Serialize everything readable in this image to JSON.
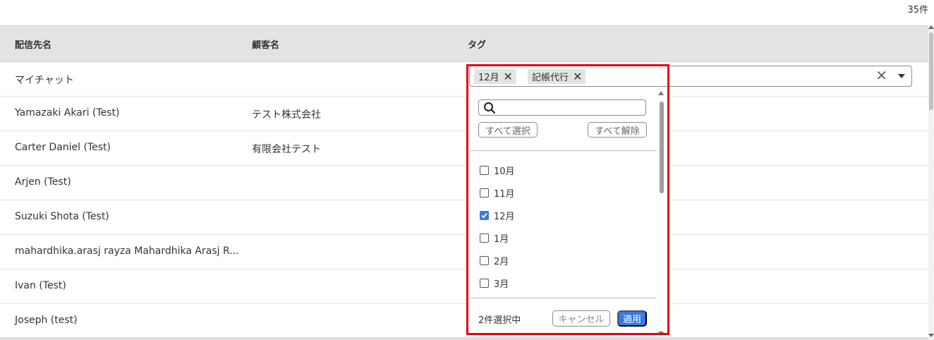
{
  "result_count": "35件",
  "table": {
    "headers": {
      "destination": "配信先名",
      "customer": "顧客名",
      "tag": "タグ"
    },
    "rows": [
      {
        "destination": "マイチャット",
        "customer": ""
      },
      {
        "destination": "Yamazaki Akari (Test)",
        "customer": "テスト株式会社"
      },
      {
        "destination": "Carter Daniel (Test)",
        "customer": "有限会社テスト"
      },
      {
        "destination": "Arjen (Test)",
        "customer": ""
      },
      {
        "destination": "Suzuki Shota (Test)",
        "customer": ""
      },
      {
        "destination": "mahardhika.arasj rayza Mahardhika Arasj R...",
        "customer": ""
      },
      {
        "destination": "Ivan (Test)",
        "customer": ""
      },
      {
        "destination": "Joseph (test)",
        "customer": ""
      }
    ]
  },
  "tag_select": {
    "chips": [
      {
        "label": "12月"
      },
      {
        "label": "記帳代行"
      }
    ],
    "clear_icon": "close-icon",
    "toggle_icon": "caret-down-icon",
    "dropdown": {
      "search_placeholder": "",
      "select_all": "すべて選択",
      "deselect_all": "すべて解除",
      "options": [
        {
          "label": "10月",
          "checked": false
        },
        {
          "label": "11月",
          "checked": false
        },
        {
          "label": "12月",
          "checked": true
        },
        {
          "label": "1月",
          "checked": false
        },
        {
          "label": "2月",
          "checked": false
        },
        {
          "label": "3月",
          "checked": false
        }
      ],
      "selected_count_text": "2件選択中",
      "cancel": "キャンセル",
      "apply": "適用"
    }
  },
  "colors": {
    "highlight": "#e60012",
    "accent": "#3b78e7",
    "header_bg": "#e3e3e3"
  }
}
